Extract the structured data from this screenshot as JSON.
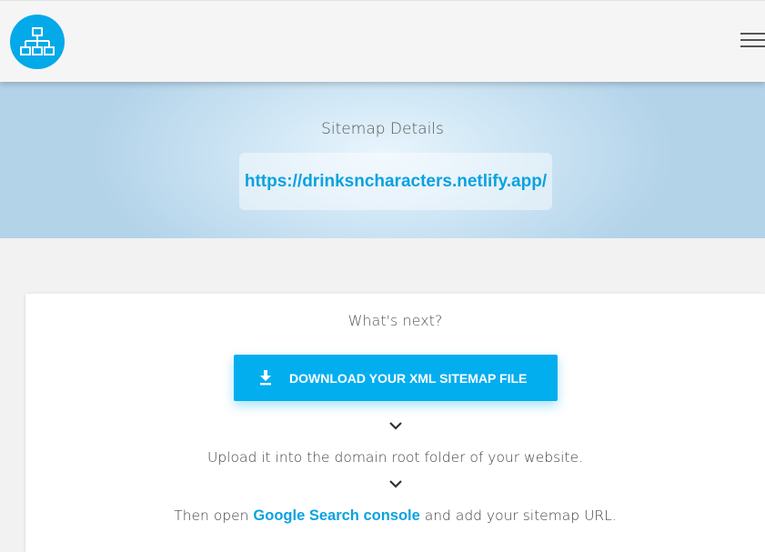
{
  "header": {
    "logo_icon": "sitemap-icon",
    "menu_icon": "hamburger-menu-icon"
  },
  "hero": {
    "title": "Sitemap Details",
    "url": "https://drinksncharacters.netlify.app/"
  },
  "next_steps": {
    "title": "What's next?",
    "download_label": "DOWNLOAD YOUR XML SITEMAP FILE",
    "download_icon": "download-icon",
    "upload_text": "Upload it into the domain root folder of your website.",
    "open_prefix": "Then open ",
    "console_link": "Google Search console",
    "open_suffix": " and add your sitemap URL."
  },
  "colors": {
    "accent": "#03aeef",
    "link": "#0aa2e0"
  }
}
